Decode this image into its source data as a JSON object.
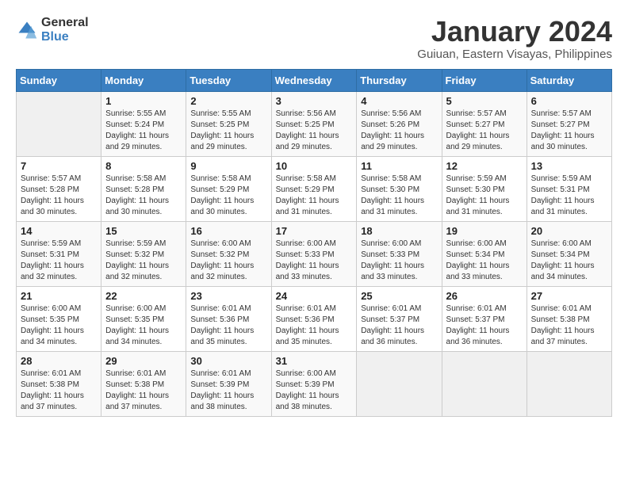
{
  "logo": {
    "general": "General",
    "blue": "Blue"
  },
  "title": "January 2024",
  "location": "Guiuan, Eastern Visayas, Philippines",
  "headers": [
    "Sunday",
    "Monday",
    "Tuesday",
    "Wednesday",
    "Thursday",
    "Friday",
    "Saturday"
  ],
  "weeks": [
    [
      {
        "day": "",
        "sunrise": "",
        "sunset": "",
        "daylight": ""
      },
      {
        "day": "1",
        "sunrise": "Sunrise: 5:55 AM",
        "sunset": "Sunset: 5:24 PM",
        "daylight": "Daylight: 11 hours and 29 minutes."
      },
      {
        "day": "2",
        "sunrise": "Sunrise: 5:55 AM",
        "sunset": "Sunset: 5:25 PM",
        "daylight": "Daylight: 11 hours and 29 minutes."
      },
      {
        "day": "3",
        "sunrise": "Sunrise: 5:56 AM",
        "sunset": "Sunset: 5:25 PM",
        "daylight": "Daylight: 11 hours and 29 minutes."
      },
      {
        "day": "4",
        "sunrise": "Sunrise: 5:56 AM",
        "sunset": "Sunset: 5:26 PM",
        "daylight": "Daylight: 11 hours and 29 minutes."
      },
      {
        "day": "5",
        "sunrise": "Sunrise: 5:57 AM",
        "sunset": "Sunset: 5:27 PM",
        "daylight": "Daylight: 11 hours and 29 minutes."
      },
      {
        "day": "6",
        "sunrise": "Sunrise: 5:57 AM",
        "sunset": "Sunset: 5:27 PM",
        "daylight": "Daylight: 11 hours and 30 minutes."
      }
    ],
    [
      {
        "day": "7",
        "sunrise": "Sunrise: 5:57 AM",
        "sunset": "Sunset: 5:28 PM",
        "daylight": "Daylight: 11 hours and 30 minutes."
      },
      {
        "day": "8",
        "sunrise": "Sunrise: 5:58 AM",
        "sunset": "Sunset: 5:28 PM",
        "daylight": "Daylight: 11 hours and 30 minutes."
      },
      {
        "day": "9",
        "sunrise": "Sunrise: 5:58 AM",
        "sunset": "Sunset: 5:29 PM",
        "daylight": "Daylight: 11 hours and 30 minutes."
      },
      {
        "day": "10",
        "sunrise": "Sunrise: 5:58 AM",
        "sunset": "Sunset: 5:29 PM",
        "daylight": "Daylight: 11 hours and 31 minutes."
      },
      {
        "day": "11",
        "sunrise": "Sunrise: 5:58 AM",
        "sunset": "Sunset: 5:30 PM",
        "daylight": "Daylight: 11 hours and 31 minutes."
      },
      {
        "day": "12",
        "sunrise": "Sunrise: 5:59 AM",
        "sunset": "Sunset: 5:30 PM",
        "daylight": "Daylight: 11 hours and 31 minutes."
      },
      {
        "day": "13",
        "sunrise": "Sunrise: 5:59 AM",
        "sunset": "Sunset: 5:31 PM",
        "daylight": "Daylight: 11 hours and 31 minutes."
      }
    ],
    [
      {
        "day": "14",
        "sunrise": "Sunrise: 5:59 AM",
        "sunset": "Sunset: 5:31 PM",
        "daylight": "Daylight: 11 hours and 32 minutes."
      },
      {
        "day": "15",
        "sunrise": "Sunrise: 5:59 AM",
        "sunset": "Sunset: 5:32 PM",
        "daylight": "Daylight: 11 hours and 32 minutes."
      },
      {
        "day": "16",
        "sunrise": "Sunrise: 6:00 AM",
        "sunset": "Sunset: 5:32 PM",
        "daylight": "Daylight: 11 hours and 32 minutes."
      },
      {
        "day": "17",
        "sunrise": "Sunrise: 6:00 AM",
        "sunset": "Sunset: 5:33 PM",
        "daylight": "Daylight: 11 hours and 33 minutes."
      },
      {
        "day": "18",
        "sunrise": "Sunrise: 6:00 AM",
        "sunset": "Sunset: 5:33 PM",
        "daylight": "Daylight: 11 hours and 33 minutes."
      },
      {
        "day": "19",
        "sunrise": "Sunrise: 6:00 AM",
        "sunset": "Sunset: 5:34 PM",
        "daylight": "Daylight: 11 hours and 33 minutes."
      },
      {
        "day": "20",
        "sunrise": "Sunrise: 6:00 AM",
        "sunset": "Sunset: 5:34 PM",
        "daylight": "Daylight: 11 hours and 34 minutes."
      }
    ],
    [
      {
        "day": "21",
        "sunrise": "Sunrise: 6:00 AM",
        "sunset": "Sunset: 5:35 PM",
        "daylight": "Daylight: 11 hours and 34 minutes."
      },
      {
        "day": "22",
        "sunrise": "Sunrise: 6:00 AM",
        "sunset": "Sunset: 5:35 PM",
        "daylight": "Daylight: 11 hours and 34 minutes."
      },
      {
        "day": "23",
        "sunrise": "Sunrise: 6:01 AM",
        "sunset": "Sunset: 5:36 PM",
        "daylight": "Daylight: 11 hours and 35 minutes."
      },
      {
        "day": "24",
        "sunrise": "Sunrise: 6:01 AM",
        "sunset": "Sunset: 5:36 PM",
        "daylight": "Daylight: 11 hours and 35 minutes."
      },
      {
        "day": "25",
        "sunrise": "Sunrise: 6:01 AM",
        "sunset": "Sunset: 5:37 PM",
        "daylight": "Daylight: 11 hours and 36 minutes."
      },
      {
        "day": "26",
        "sunrise": "Sunrise: 6:01 AM",
        "sunset": "Sunset: 5:37 PM",
        "daylight": "Daylight: 11 hours and 36 minutes."
      },
      {
        "day": "27",
        "sunrise": "Sunrise: 6:01 AM",
        "sunset": "Sunset: 5:38 PM",
        "daylight": "Daylight: 11 hours and 37 minutes."
      }
    ],
    [
      {
        "day": "28",
        "sunrise": "Sunrise: 6:01 AM",
        "sunset": "Sunset: 5:38 PM",
        "daylight": "Daylight: 11 hours and 37 minutes."
      },
      {
        "day": "29",
        "sunrise": "Sunrise: 6:01 AM",
        "sunset": "Sunset: 5:38 PM",
        "daylight": "Daylight: 11 hours and 37 minutes."
      },
      {
        "day": "30",
        "sunrise": "Sunrise: 6:01 AM",
        "sunset": "Sunset: 5:39 PM",
        "daylight": "Daylight: 11 hours and 38 minutes."
      },
      {
        "day": "31",
        "sunrise": "Sunrise: 6:00 AM",
        "sunset": "Sunset: 5:39 PM",
        "daylight": "Daylight: 11 hours and 38 minutes."
      },
      {
        "day": "",
        "sunrise": "",
        "sunset": "",
        "daylight": ""
      },
      {
        "day": "",
        "sunrise": "",
        "sunset": "",
        "daylight": ""
      },
      {
        "day": "",
        "sunrise": "",
        "sunset": "",
        "daylight": ""
      }
    ]
  ]
}
